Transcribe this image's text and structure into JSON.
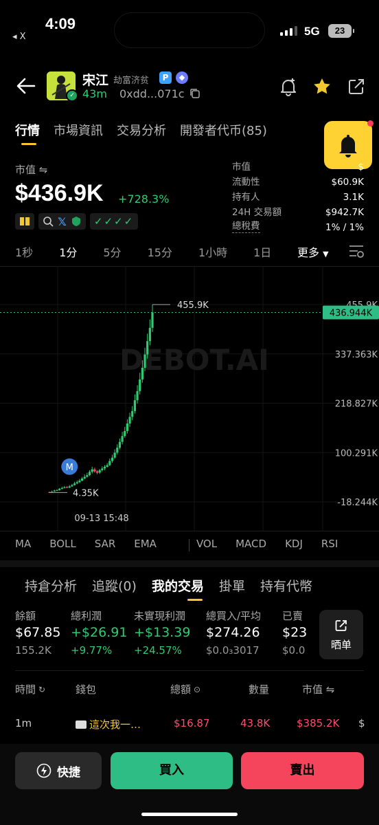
{
  "status": {
    "time": "4:09",
    "back_app": "◂ X",
    "network": "5G",
    "battery": "23"
  },
  "header": {
    "token_name": "宋江",
    "token_subtitle": "劫富济贫",
    "age": "43m",
    "address": "0xdd...071c",
    "icons": [
      "back-arrow-icon",
      "alarm-add-icon",
      "star-icon",
      "share-icon"
    ]
  },
  "tabs": [
    "行情",
    "市場資訊",
    "交易分析",
    "開發者代币(85)"
  ],
  "market": {
    "label": "市值 ⇋",
    "value": "$436.9K",
    "change": "+728.3%",
    "stats": [
      {
        "k": "市值",
        "v": "$"
      },
      {
        "k": "流動性",
        "v": "$60.9K"
      },
      {
        "k": "持有人",
        "v": "3.1K"
      },
      {
        "k": "24H 交易額",
        "v": "$942.7K"
      },
      {
        "k": "總稅費",
        "v": "1% / 1%"
      }
    ],
    "checks": "✓✓✓✓"
  },
  "timeframes": [
    "1秒",
    "1分",
    "5分",
    "15分",
    "1小時",
    "1日"
  ],
  "more_label": "更多",
  "chart_data": {
    "type": "candlestick",
    "watermark": "DEBOT.AI",
    "high_label": "455.9K",
    "low_label": "4.35K",
    "current_price": "436.944K",
    "marker": "M",
    "x_label": "09-13 15:48",
    "y_ticks": [
      "455.9K",
      "337.363K",
      "218.827K",
      "100.291K",
      "-18.244K"
    ],
    "ylim": [
      -18.244,
      455.9
    ],
    "candles": [
      [
        5,
        4.35,
        7,
        4.35
      ],
      [
        6,
        6,
        9,
        5
      ],
      [
        7,
        9,
        11,
        6
      ],
      [
        9,
        10,
        12,
        8
      ],
      [
        10,
        13,
        15,
        9
      ],
      [
        13,
        15,
        18,
        12
      ],
      [
        15,
        17,
        20,
        14
      ],
      [
        17,
        16,
        20,
        15
      ],
      [
        16,
        19,
        22,
        15
      ],
      [
        19,
        22,
        25,
        18
      ],
      [
        22,
        26,
        30,
        21
      ],
      [
        26,
        29,
        33,
        24
      ],
      [
        29,
        33,
        37,
        27
      ],
      [
        33,
        38,
        42,
        31
      ],
      [
        38,
        42,
        48,
        36
      ],
      [
        42,
        46,
        52,
        40
      ],
      [
        46,
        54,
        58,
        44
      ],
      [
        54,
        60,
        66,
        50
      ],
      [
        60,
        55,
        64,
        52
      ],
      [
        55,
        52,
        58,
        48
      ],
      [
        52,
        58,
        61,
        49
      ],
      [
        58,
        62,
        67,
        55
      ],
      [
        62,
        66,
        70,
        58
      ],
      [
        66,
        70,
        75,
        64
      ],
      [
        70,
        80,
        86,
        68
      ],
      [
        80,
        88,
        95,
        76
      ],
      [
        88,
        100,
        108,
        85
      ],
      [
        100,
        112,
        120,
        96
      ],
      [
        112,
        126,
        134,
        108
      ],
      [
        126,
        140,
        150,
        120
      ],
      [
        140,
        152,
        162,
        136
      ],
      [
        152,
        170,
        180,
        146
      ],
      [
        170,
        186,
        196,
        162
      ],
      [
        186,
        200,
        212,
        178
      ],
      [
        200,
        226,
        240,
        194
      ],
      [
        226,
        248,
        262,
        218
      ],
      [
        248,
        276,
        292,
        240
      ],
      [
        276,
        304,
        322,
        268
      ],
      [
        304,
        336,
        352,
        296
      ],
      [
        336,
        368,
        386,
        326
      ],
      [
        368,
        400,
        420,
        358
      ],
      [
        400,
        436.9,
        455.9,
        390
      ]
    ]
  },
  "indicators": [
    "MA",
    "BOLL",
    "SAR",
    "EMA",
    "VOL",
    "MACD",
    "KDJ",
    "RSI"
  ],
  "bottom_tabs": [
    "持倉分析",
    "追蹤(0)",
    "我的交易",
    "掛單",
    "持有代幣"
  ],
  "pnl": [
    {
      "k": "餘額",
      "v": "$67.85",
      "s": "155.2K",
      "green": false
    },
    {
      "k": "總利潤",
      "v": "+$26.91",
      "s": "+9.77%",
      "green": true
    },
    {
      "k": "未實現利潤",
      "v": "+$13.39",
      "s": "+24.57%",
      "green": true
    },
    {
      "k": "總買入/平均",
      "v": "$274.26",
      "s": "$0.0₃3017",
      "green": false
    },
    {
      "k": "已賣",
      "v": "$23",
      "s": "$0.0",
      "green": false
    }
  ],
  "share_label": "晒单",
  "table": {
    "headers": [
      "時間",
      "錢包",
      "總額",
      "數量",
      "市值 ⇋"
    ],
    "rows": [
      {
        "time": "1m",
        "wallet": "這次我一…",
        "total": "$16.87",
        "qty": "43.8K",
        "mcap": "$385.2K",
        "extra": "$"
      }
    ]
  },
  "actions": {
    "quick": "快捷",
    "buy": "買入",
    "sell": "賣出"
  },
  "colors": {
    "accent": "#f3c82f",
    "up": "#2ecc71",
    "down": "#ff4d6d",
    "buy": "#2ebd85",
    "sell": "#f5455c"
  }
}
